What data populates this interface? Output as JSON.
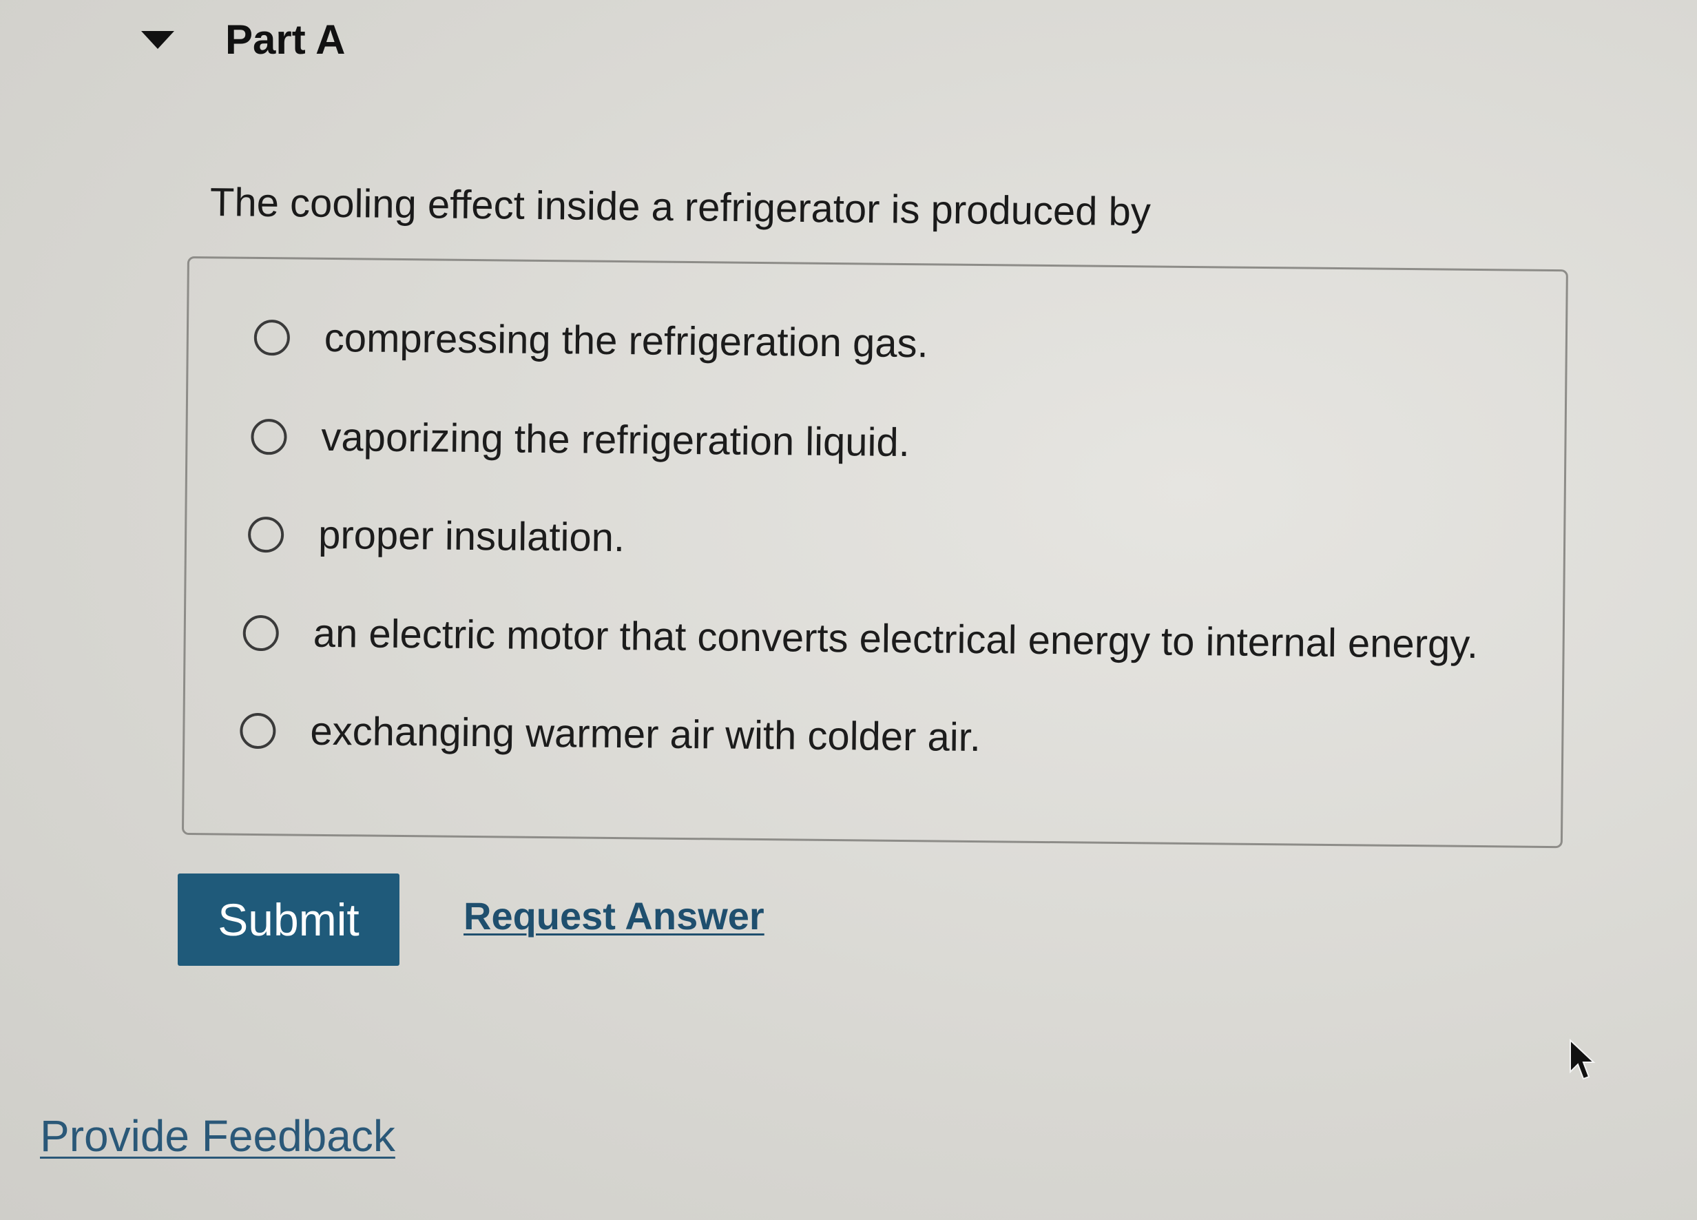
{
  "part": {
    "title": "Part A",
    "collapse_icon": "caret-down-icon"
  },
  "question": {
    "prompt": "The cooling effect inside a refrigerator is produced by"
  },
  "options": [
    {
      "label": "compressing the refrigeration gas.",
      "selected": false
    },
    {
      "label": "vaporizing the refrigeration liquid.",
      "selected": false
    },
    {
      "label": "proper insulation.",
      "selected": false
    },
    {
      "label": "an electric motor that converts electrical energy to internal energy.",
      "selected": false
    },
    {
      "label": "exchanging warmer air with colder air.",
      "selected": false
    }
  ],
  "actions": {
    "submit_label": "Submit",
    "request_answer_label": "Request Answer"
  },
  "footer": {
    "feedback_label": "Provide Feedback"
  },
  "colors": {
    "submit_bg": "#1f5a7a",
    "link": "#1f4f6e",
    "background": "#dcdbd6"
  },
  "pointer": "mouse-pointer-icon"
}
